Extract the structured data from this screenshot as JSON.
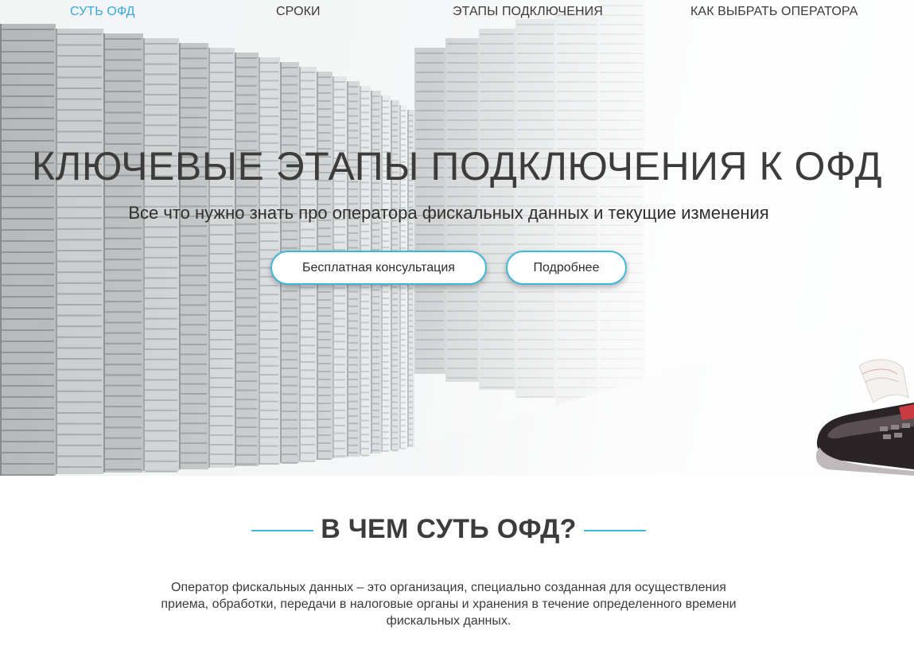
{
  "nav": {
    "items": [
      {
        "label": "СУТЬ ОФД",
        "active": true
      },
      {
        "label": "СРОКИ",
        "active": false
      },
      {
        "label": "ЭТАПЫ ПОДКЛЮЧЕНИЯ",
        "active": false
      },
      {
        "label": "КАК ВЫБРАТЬ ОПЕРАТОРА",
        "active": false
      }
    ]
  },
  "hero": {
    "title": "КЛЮЧЕВЫЕ ЭТАПЫ ПОДКЛЮЧЕНИЯ К ОФД",
    "subtitle": "Все что нужно знать про оператора фискальных данных и текущие изменения",
    "buttons": {
      "consult_label": "Бесплатная консультация",
      "more_label": "Подробнее"
    },
    "background_icon": "server-room-image",
    "terminal_icon": "cash-register-terminal-image"
  },
  "section": {
    "title": "В ЧЕМ СУТЬ ОФД?",
    "text": "Оператор фискальных данных – это организация, специально созданная для осуществления приема, обработки, передачи в налоговые органы и хранения в течение определенного времени фискальных данных."
  },
  "colors": {
    "accent": "#3aa9dd",
    "button_border": "#3fb6db",
    "text": "#3c3c3c"
  }
}
